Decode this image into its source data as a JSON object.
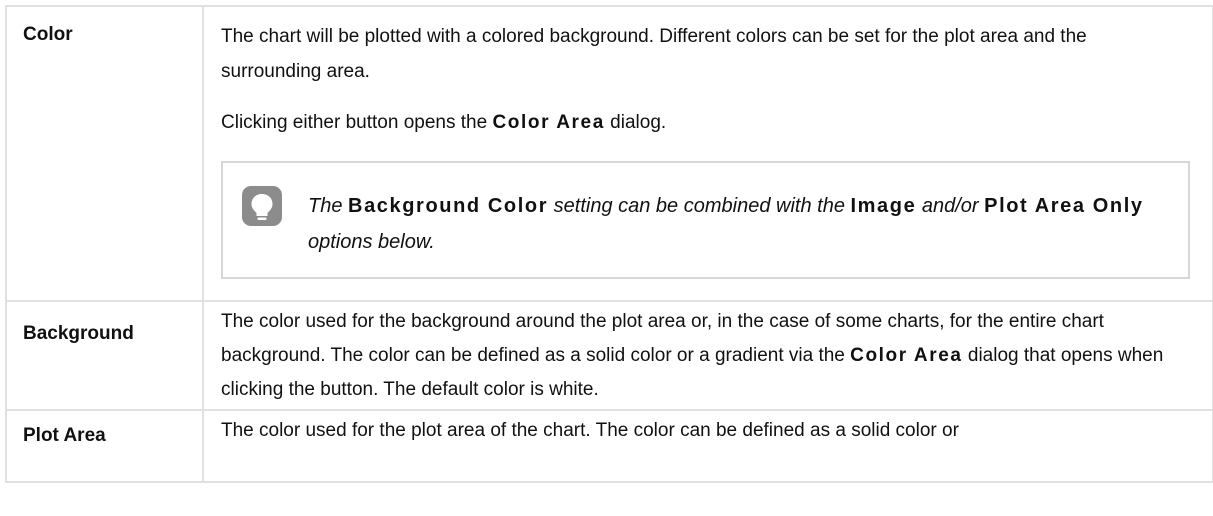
{
  "rows": [
    {
      "term": "Color",
      "desc_line1": "The chart will be plotted with a colored background. Different colors can be set for the plot area and the surrounding area.",
      "desc_line2_pre": "Clicking either button opens the ",
      "desc_line2_term": "Color Area",
      "desc_line2_post": " dialog.",
      "tip": {
        "icon": "lightbulb-icon",
        "pre": "The ",
        "term1": "Background Color",
        "mid": " setting can be combined with the ",
        "term2": "Image",
        "mid2": " and/or ",
        "term3": "Plot Area Only",
        "post": " options below."
      }
    },
    {
      "term": "Background",
      "desc_pre": "The color used for the background around the plot area or, in the case of some charts, for the entire chart background. The color can be defined as a solid color or a gradient via the ",
      "desc_term": "Color Area",
      "desc_post": " dialog that opens when clicking the button. The default color is white."
    },
    {
      "term": "Plot Area",
      "desc": "The color used for the plot area of the chart. The color can be defined as a solid color or"
    }
  ]
}
